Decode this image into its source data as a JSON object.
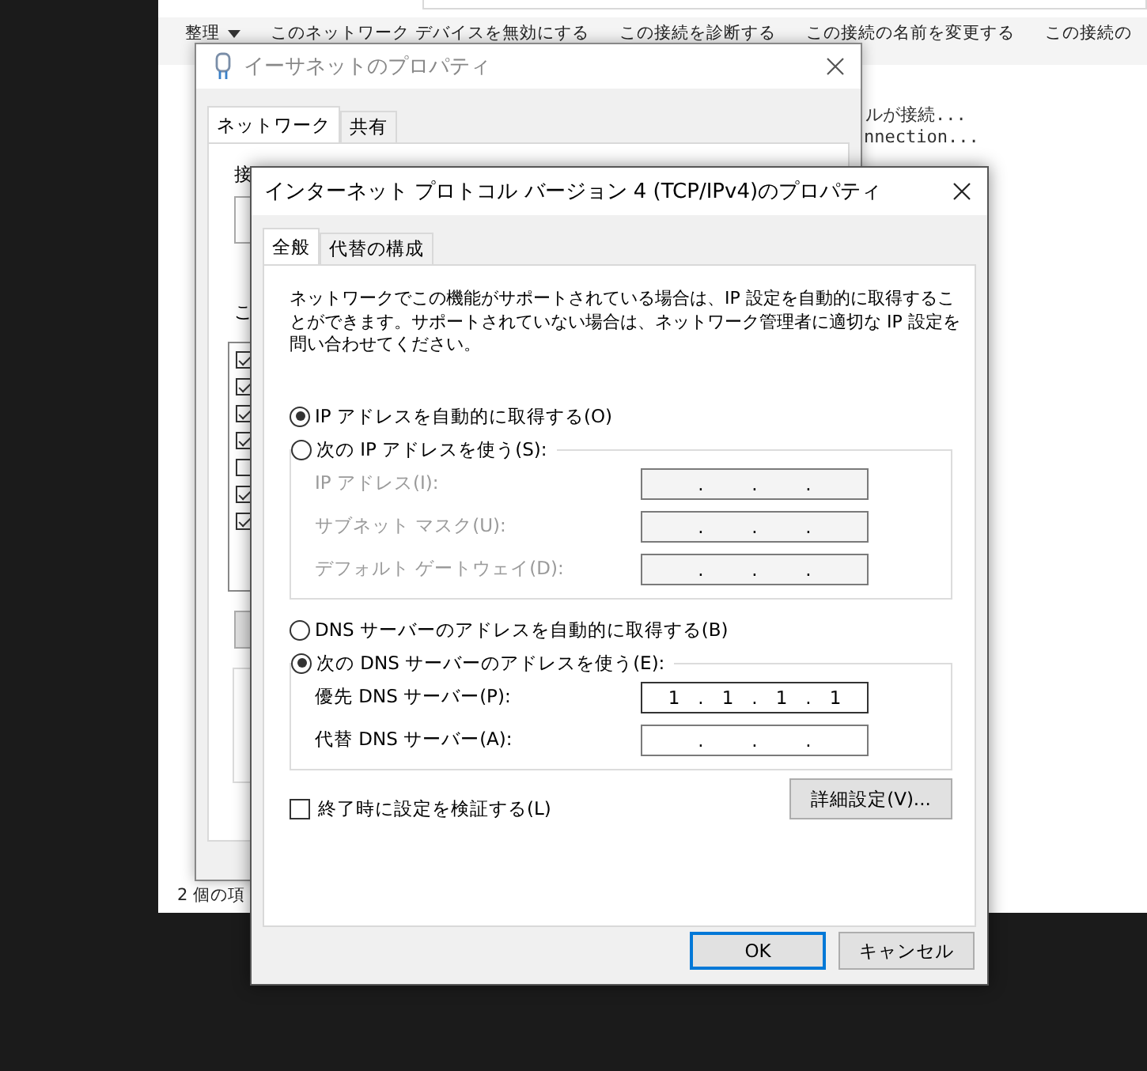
{
  "explorer": {
    "toolbar": [
      {
        "label": "整理",
        "dropdown": true
      },
      {
        "label": "このネットワーク デバイスを無効にする",
        "dropdown": false
      },
      {
        "label": "この接続を診断する",
        "dropdown": false
      },
      {
        "label": "この接続の名前を変更する",
        "dropdown": false
      },
      {
        "label": "この接続の",
        "dropdown": false
      }
    ],
    "details": [
      "ルが接続...",
      "nnection..."
    ],
    "status_bar": "2 個の項"
  },
  "ethernet_dialog": {
    "title": "イーサネットのプロパティ",
    "tabs": [
      {
        "label": "ネットワーク",
        "selected": true
      },
      {
        "label": "共有",
        "selected": false
      }
    ],
    "labels": [
      "接",
      "こ"
    ],
    "items": [
      {
        "checked": true
      },
      {
        "checked": true
      },
      {
        "checked": true
      },
      {
        "checked": true
      },
      {
        "checked": false
      },
      {
        "checked": true
      },
      {
        "checked": true
      }
    ]
  },
  "ipv4_dialog": {
    "title": "インターネット プロトコル バージョン 4 (TCP/IPv4)のプロパティ",
    "tabs": [
      {
        "label": "全般",
        "selected": true
      },
      {
        "label": "代替の構成",
        "selected": false
      }
    ],
    "description": "ネットワークでこの機能がサポートされている場合は、IP 設定を自動的に取得することができます。サポートされていない場合は、ネットワーク管理者に適切な IP 設定を問い合わせてください。",
    "octet_separator": ".",
    "ip_auto": {
      "label": "IP アドレスを自動的に取得する(O)",
      "selected": true
    },
    "ip_group": {
      "radio": {
        "label": "次の IP アドレスを使う(S):",
        "selected": false
      },
      "disabled": true,
      "fields": [
        {
          "label": "IP アドレス(I):",
          "focused": false
        },
        {
          "label": "サブネット マスク(U):",
          "focused": false
        },
        {
          "label": "デフォルト ゲートウェイ(D):",
          "focused": false
        }
      ]
    },
    "dns_auto": {
      "label": "DNS サーバーのアドレスを自動的に取得する(B)",
      "selected": false
    },
    "dns_group": {
      "radio": {
        "label": "次の DNS サーバーのアドレスを使う(E):",
        "selected": true
      },
      "disabled": false,
      "fields": [
        {
          "label": "優先 DNS サーバー(P):",
          "octets": [
            "1",
            "1",
            "1",
            "1"
          ],
          "focused": true
        },
        {
          "label": "代替 DNS サーバー(A):",
          "focused": false
        }
      ]
    },
    "validate": {
      "label": "終了時に設定を検証する(L)",
      "checked": false
    },
    "advanced_button": "詳細設定(V)...",
    "buttons": [
      {
        "label": "OK",
        "default": true
      },
      {
        "label": "キャンセル",
        "default": false
      }
    ]
  }
}
